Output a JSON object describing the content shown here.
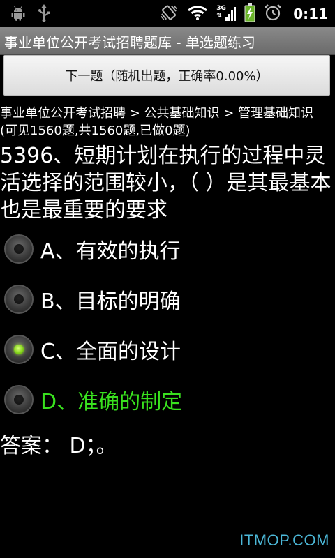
{
  "status_bar": {
    "icons_left": [
      "android-debug-icon",
      "usb-icon"
    ],
    "icons_right": [
      "vibrate-icon",
      "wifi-icon",
      "signal-3g-icon",
      "battery-charging-icon",
      "alarm-icon"
    ],
    "network_label": "3G",
    "time": "0:11"
  },
  "title_bar": {
    "title": "事业单位公开考试招聘题库 - 单选题练习"
  },
  "next_button": {
    "label": "下一题（随机出题，正确率0.00%）"
  },
  "breadcrumb": "事业单位公开考试招聘 > 公共基础知识 > 管理基础知识 (可见1560题,共1560题,已做0题)",
  "question": "5396、短期计划在执行的过程中灵活选择的范围较小，（  ）是其最基本也是最重要的要求",
  "options": [
    {
      "label": "A、有效的执行",
      "checked": false,
      "correct": false
    },
    {
      "label": "B、目标的明确",
      "checked": false,
      "correct": false
    },
    {
      "label": "C、全面的设计",
      "checked": true,
      "correct": false
    },
    {
      "label": "D、准确的制定",
      "checked": false,
      "correct": true
    }
  ],
  "answer": "答案： D；。",
  "watermark": "ITMOP.COM",
  "colors": {
    "correct_option": "#39e11e",
    "checked_radio": "#84d31c",
    "title_bar": "#7a7a7a",
    "watermark": "#4cb8d8"
  }
}
